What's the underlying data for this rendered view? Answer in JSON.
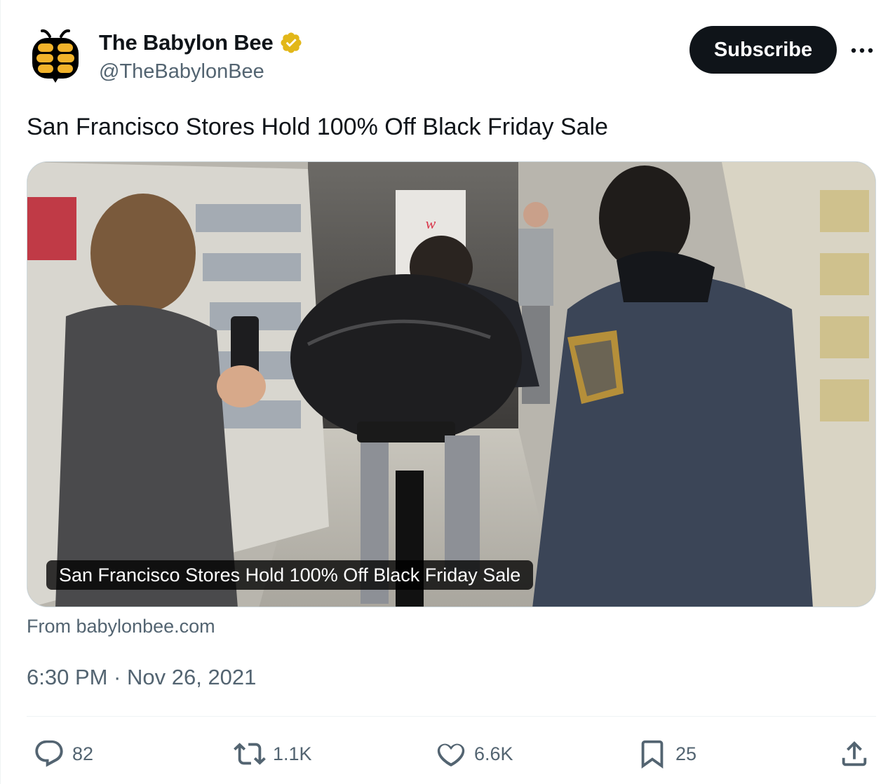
{
  "author": {
    "name": "The Babylon Bee",
    "handle": "@TheBabylonBee",
    "verified_color": "#e2b719"
  },
  "header": {
    "subscribe_label": "Subscribe",
    "more_icon": "more-horizontal-icon"
  },
  "tweet": {
    "text": "San Francisco Stores Hold 100% Off Black Friday Sale",
    "media_caption": "San Francisco Stores Hold 100% Off Black Friday Sale",
    "source": "From babylonbee.com",
    "timestamp": "6:30 PM · Nov 26, 2021"
  },
  "actions": {
    "replies": "82",
    "retweets": "1.1K",
    "likes": "6.6K",
    "bookmarks": "25"
  },
  "colors": {
    "text_primary": "#0f1419",
    "text_secondary": "#536471",
    "button_bg": "#0f1419",
    "divider": "#eff3f4"
  }
}
